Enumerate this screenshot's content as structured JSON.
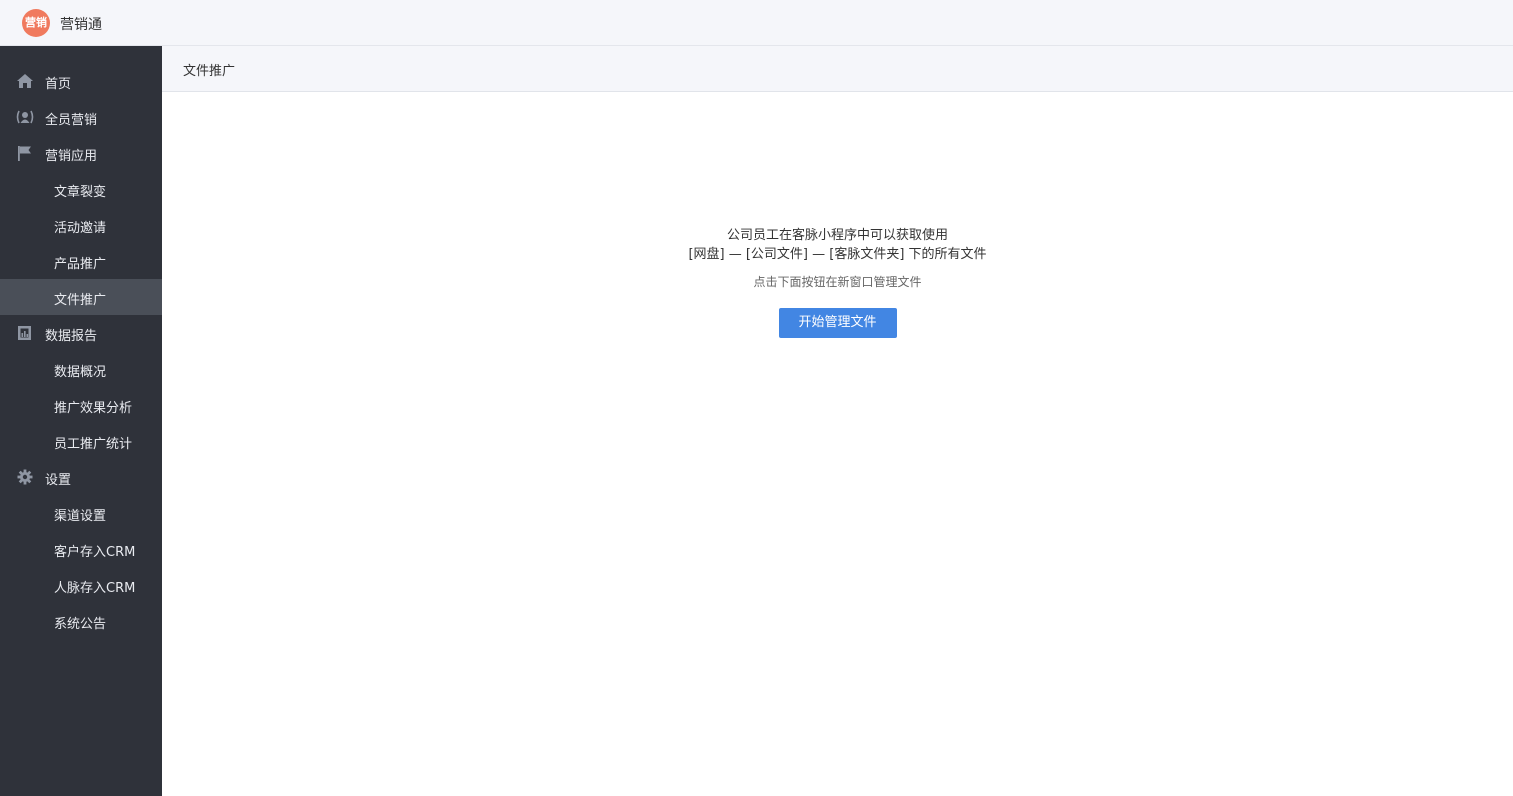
{
  "app": {
    "logo_text": "营销",
    "title": "营销通"
  },
  "sidebar": {
    "items": [
      {
        "label": "首页",
        "type": "parent",
        "icon": "home-icon"
      },
      {
        "label": "全员营销",
        "type": "parent",
        "icon": "people-icon"
      },
      {
        "label": "营销应用",
        "type": "parent",
        "icon": "flag-icon"
      },
      {
        "label": "文章裂变",
        "type": "child"
      },
      {
        "label": "活动邀请",
        "type": "child"
      },
      {
        "label": "产品推广",
        "type": "child"
      },
      {
        "label": "文件推广",
        "type": "child",
        "active": true
      },
      {
        "label": "数据报告",
        "type": "parent",
        "icon": "report-icon"
      },
      {
        "label": "数据概况",
        "type": "child"
      },
      {
        "label": "推广效果分析",
        "type": "child"
      },
      {
        "label": "员工推广统计",
        "type": "child"
      },
      {
        "label": "设置",
        "type": "parent",
        "icon": "gear-icon"
      },
      {
        "label": "渠道设置",
        "type": "child"
      },
      {
        "label": "客户存入CRM",
        "type": "child"
      },
      {
        "label": "人脉存入CRM",
        "type": "child"
      },
      {
        "label": "系统公告",
        "type": "child"
      }
    ]
  },
  "header": {
    "title": "文件推广"
  },
  "main": {
    "line1": "公司员工在客脉小程序中可以获取使用",
    "line2": "[网盘] — [公司文件] — [客脉文件夹] 下的所有文件",
    "hint": "点击下面按钮在新窗口管理文件",
    "button_label": "开始管理文件"
  },
  "colors": {
    "sidebar_bg": "#2f323a",
    "active_bg": "#4a4f58",
    "accent": "#4286e3",
    "logo": "#f07a5e"
  }
}
